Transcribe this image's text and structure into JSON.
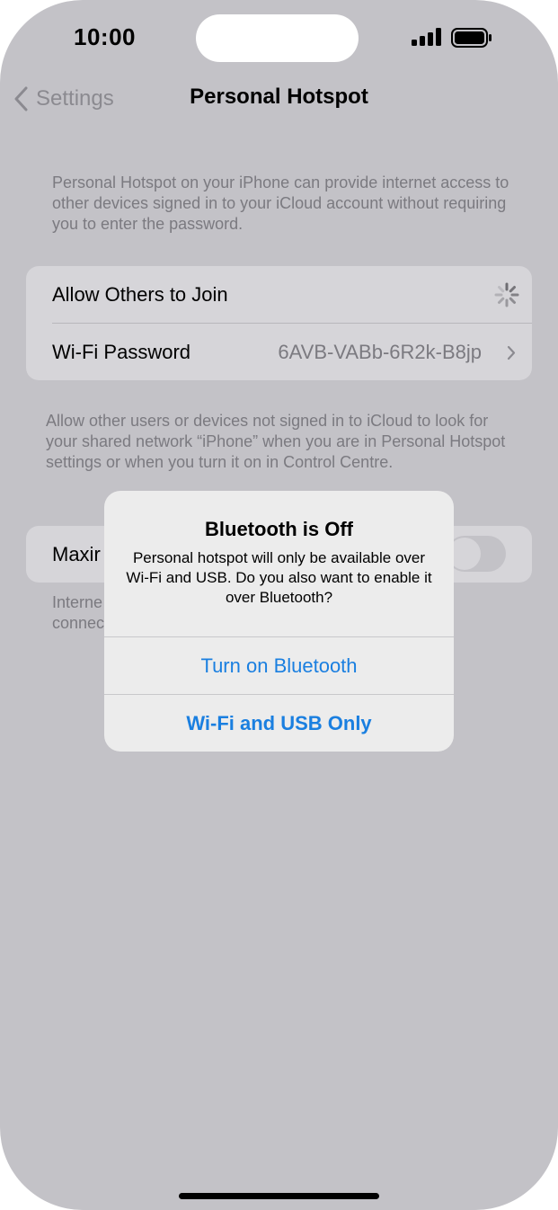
{
  "status_bar": {
    "time": "10:00"
  },
  "nav": {
    "back_label": "Settings",
    "title": "Personal Hotspot"
  },
  "intro_text": "Personal Hotspot on your iPhone can provide internet access to other devices signed in to your iCloud account without requiring you to enter the password.",
  "hotspot_group": {
    "allow_label": "Allow Others to Join",
    "wifi_password_label": "Wi-Fi Password",
    "wifi_password_value": "6AVB-VABb-6R2k-B8jp"
  },
  "allow_footer": "Allow other users or devices not signed in to iCloud to look for your shared network “iPhone” when you are in Personal Hotspot settings or when you turn it on in Control Centre.",
  "compat_group": {
    "label_partial": "Maxir"
  },
  "compat_footer_partial": "Interne\nconnec",
  "alert": {
    "title": "Bluetooth is Off",
    "message": "Personal hotspot will only be available over Wi-Fi and USB. Do you also want to enable it over Bluetooth?",
    "primary_button": "Turn on Bluetooth",
    "secondary_button": "Wi-Fi and USB Only",
    "accent_color": "#1a7fe0"
  }
}
